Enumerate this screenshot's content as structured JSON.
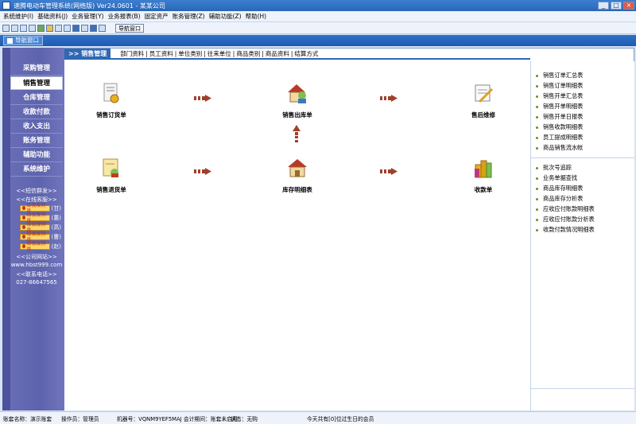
{
  "window": {
    "title": "速腾电动车管理系统(网络版) Ver24.0601 - 某某公司",
    "min": "_",
    "max": "□",
    "close": "×"
  },
  "menu": [
    "系统维护(I)",
    "基础资料(J)",
    "业务管理(Y)",
    "业务报表(B)",
    "固定资产",
    "账务管理(Z)",
    "辅助功能(Z)",
    "帮助(H)"
  ],
  "toolbar": {
    "nav_button": "导航窗口"
  },
  "nav_tab": {
    "label": "导航窗口"
  },
  "sidebar": {
    "items": [
      "采购管理",
      "销售管理",
      "仓库管理",
      "收款付款",
      "收入支出",
      "账务管理",
      "辅助功能",
      "系统维护"
    ],
    "active_index": 1,
    "info": {
      "sms": "<<短信群发>>",
      "service": "<<在线客服>>",
      "website_title": "<<公司网站>>",
      "website": "www.hbst999.com",
      "phone_title": "<<联系电话>>",
      "phone": "027-86647565"
    },
    "qq": [
      {
        "pill": "给我发消息",
        "tag": "(甘)"
      },
      {
        "pill": "给我发消息",
        "tag": "(惠)"
      },
      {
        "pill": "给我发消息",
        "tag": "(高)"
      },
      {
        "pill": "给我发消息",
        "tag": "(曹)"
      },
      {
        "pill": "给我发消息",
        "tag": "(赵)"
      }
    ]
  },
  "subnav": {
    "current": ">> 销售管理",
    "links": [
      "部门资料",
      "员工资料",
      "单位类别",
      "往来单位",
      "商品类别",
      "商品资料",
      "结算方式"
    ]
  },
  "flow": {
    "sales_order": "销售订货单",
    "sales_outbound": "销售出库单",
    "after_sales": "售后维修",
    "sales_return": "销售退货单",
    "inventory_detail": "库存明细表",
    "receipt": "收款单"
  },
  "right_panel": {
    "group1": [
      "销售订单汇总表",
      "销售订单明细表",
      "销售开单汇总表",
      "销售开单明细表",
      "销售开单日报表",
      "销售收款明细表",
      "员工提成明细表",
      "商品销售流水帐"
    ],
    "group2": [
      "批次号追踪",
      "业务单据查找",
      "商品库存明细表",
      "商品库存分析表",
      "应收应付账款明细表",
      "应收应付账款分析表",
      "收款付款情况明细表"
    ]
  },
  "status": {
    "account": "账套名称：演示账套",
    "operator": "操作员：管理员",
    "machine": "机器号：VQNM9YEF5MAJ 会计期间：账套未启用",
    "state": "状态：无购",
    "birthday": "今天共有[0]位过生日的会员"
  },
  "colors": {
    "sidebar": "#6a70b8",
    "accent": "#2f67b3",
    "arrow": "#a0402a"
  }
}
